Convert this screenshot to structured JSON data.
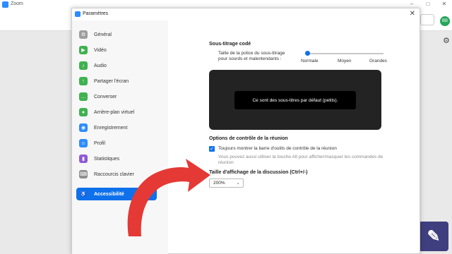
{
  "background_app": {
    "title": "Zoom",
    "avatar_initials": "BB"
  },
  "dialog": {
    "title": "Paramètres",
    "close_glyph": "✕"
  },
  "sidebar": {
    "items": [
      {
        "label": "Général",
        "icon": "gear-icon",
        "color": "#9e9e9e"
      },
      {
        "label": "Vidéo",
        "icon": "video-icon",
        "color": "#3fb24f"
      },
      {
        "label": "Audio",
        "icon": "headphones-icon",
        "color": "#3fb24f"
      },
      {
        "label": "Partager l'écran",
        "icon": "share-screen-icon",
        "color": "#3fb24f"
      },
      {
        "label": "Converser",
        "icon": "chat-icon",
        "color": "#3fb24f"
      },
      {
        "label": "Arrière-plan virtuel",
        "icon": "person-background-icon",
        "color": "#3fb24f"
      },
      {
        "label": "Enregistrement",
        "icon": "record-icon",
        "color": "#2d8cff"
      },
      {
        "label": "Profil",
        "icon": "profile-icon",
        "color": "#2d8cff"
      },
      {
        "label": "Statistiques",
        "icon": "stats-icon",
        "color": "#8e5ad6"
      },
      {
        "label": "Raccourcis clavier",
        "icon": "keyboard-icon",
        "color": "#8e8e8e"
      },
      {
        "label": "Accessibilité",
        "icon": "accessibility-icon",
        "color": "#0e71eb",
        "active": true
      }
    ]
  },
  "captions": {
    "title": "Sous-titrage codé",
    "font_size_label_1": "Taille de la police du sous-titrage",
    "font_size_label_2": "pour sourds et malentendants :",
    "slider_value": 0,
    "slider_labels": [
      "Normale",
      "Moyen",
      "Grandes"
    ],
    "preview_text": "Ce sont des sous-titres par défaut (petits)."
  },
  "meeting_controls": {
    "title": "Options de contrôle de la réunion",
    "checkbox_label": "Toujours montrer la barre d'outils de contrôle de la réunion",
    "checkbox_checked": true,
    "hint_1": "Vous pouvez aussi utiliser la touche Alt pour afficher/masquer les commandes de",
    "hint_2": "réunion"
  },
  "chat_size": {
    "title": "Taille d'affichage de la discussion (Ctrl+/-)",
    "value": "200%"
  },
  "colors": {
    "accent": "#0e71eb",
    "arrow": "#e53935"
  }
}
